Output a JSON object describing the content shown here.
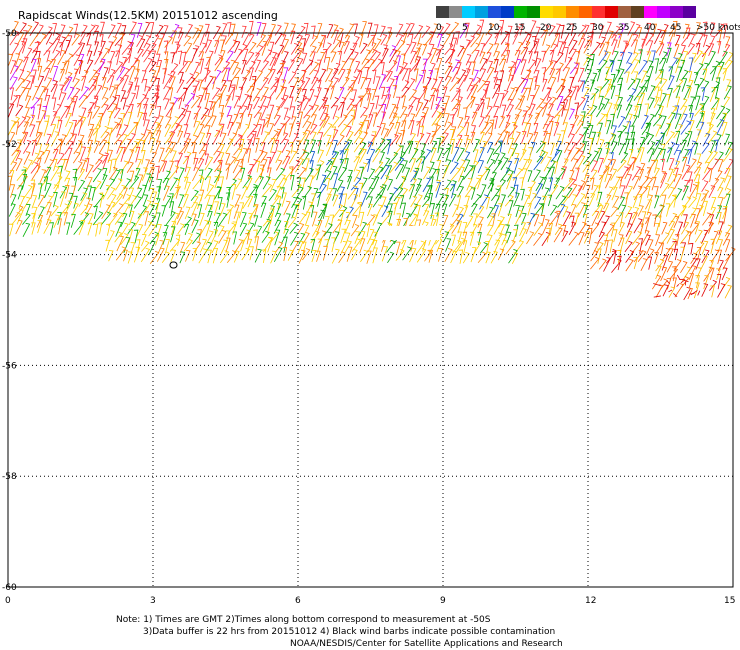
{
  "header": {
    "title": "Rapidscat Winds(12.5KM) 20151012 ascending"
  },
  "colorbar": {
    "colors": [
      "#404040",
      "#8c8c8c",
      "#00ccff",
      "#00a0e0",
      "#1e50dc",
      "#003cc8",
      "#00b400",
      "#009000",
      "#ffdc00",
      "#ffc800",
      "#ff8c00",
      "#ff6400",
      "#ff3030",
      "#e00000",
      "#a06040",
      "#604020",
      "#ff00ff",
      "#c000ff",
      "#8c00c8",
      "#5a00a0"
    ],
    "labels": [
      "0",
      "5",
      "10",
      "15",
      "20",
      "25",
      "30",
      "35",
      "40",
      "45",
      ">50 knots"
    ]
  },
  "map": {
    "lat_labels": [
      "-50",
      "-52",
      "-54",
      "-56",
      "-58",
      "-60"
    ],
    "lon_labels": [
      "0",
      "3",
      "6",
      "9",
      "12",
      "15"
    ]
  },
  "notes": {
    "line1": "Note: 1) Times are GMT 2)Times along bottom correspond to measurement at -50S",
    "line2": "3)Data buffer is 22 hrs from 20151012 4) Black wind barbs indicate possible contamination",
    "line3": "NOAA/NESDIS/Center for Satellite Applications and Research"
  }
}
